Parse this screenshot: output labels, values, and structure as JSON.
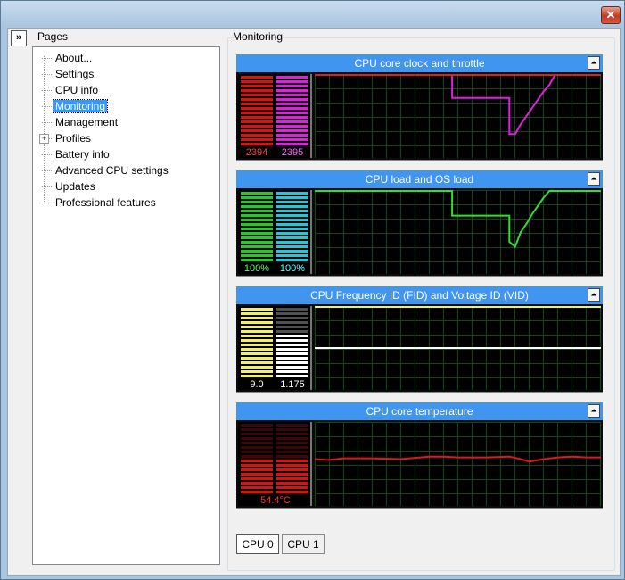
{
  "window": {
    "close_glyph": "✕",
    "close_icon": "close-icon"
  },
  "sidebar": {
    "expand_glyph": "»",
    "heading": "Pages",
    "items": [
      {
        "label": "About..."
      },
      {
        "label": "Settings"
      },
      {
        "label": "CPU info"
      },
      {
        "label": "Monitoring",
        "selected": true
      },
      {
        "label": "Management"
      },
      {
        "label": "Profiles",
        "expandable": true
      },
      {
        "label": "Battery info"
      },
      {
        "label": "Advanced CPU settings"
      },
      {
        "label": "Updates"
      },
      {
        "label": "Professional features"
      }
    ]
  },
  "main": {
    "heading": "Monitoring",
    "collapse_glyph": "⏶",
    "panels": [
      {
        "title": "CPU core clock and throttle",
        "meters": [
          {
            "value": "2394",
            "color": "#e01010",
            "text_color": "#ff4040",
            "fill": 1.0
          },
          {
            "value": "2395",
            "color": "#e020e0",
            "text_color": "#ff60ff",
            "fill": 1.0
          }
        ],
        "series": [
          {
            "color": "#e020e0",
            "points": [
              [
                0,
                100
              ],
              [
                48,
                100
              ],
              [
                48,
                72
              ],
              [
                68,
                72
              ],
              [
                68,
                28
              ],
              [
                70,
                28
              ],
              [
                72,
                40
              ],
              [
                74,
                50
              ],
              [
                76,
                60
              ],
              [
                78,
                70
              ],
              [
                80,
                80
              ],
              [
                82,
                88
              ],
              [
                84,
                100
              ],
              [
                100,
                100
              ]
            ]
          },
          {
            "color": "#e02020",
            "points": [
              [
                0,
                100
              ],
              [
                100,
                100
              ]
            ]
          }
        ]
      },
      {
        "title": "CPU load and OS load",
        "meters": [
          {
            "value": "100%",
            "color": "#22cc22",
            "text_color": "#60ff60",
            "fill": 1.0
          },
          {
            "value": "100%",
            "color": "#22c8d8",
            "text_color": "#60ffff",
            "fill": 1.0
          }
        ],
        "series": [
          {
            "color": "#30e030",
            "points": [
              [
                0,
                100
              ],
              [
                48,
                100
              ],
              [
                48,
                70
              ],
              [
                68,
                70
              ],
              [
                68,
                38
              ],
              [
                70,
                32
              ],
              [
                72,
                50
              ],
              [
                74,
                60
              ],
              [
                76,
                72
              ],
              [
                78,
                82
              ],
              [
                80,
                92
              ],
              [
                82,
                100
              ],
              [
                100,
                100
              ]
            ]
          }
        ]
      },
      {
        "title": "CPU Frequency ID (FID) and Voltage ID (VID)",
        "meters": [
          {
            "value": "9.0",
            "color": "#f0f060",
            "text_color": "#ffffff",
            "fill": 1.0
          },
          {
            "value": "1.175",
            "color": "#ffffff",
            "text_color": "#ffffff",
            "fill": 0.6,
            "dim": "#505050"
          }
        ],
        "series": [
          {
            "color": "#f0f060",
            "points": [
              [
                0,
                100
              ],
              [
                100,
                100
              ]
            ]
          },
          {
            "color": "#ffffff",
            "points": [
              [
                0,
                50
              ],
              [
                100,
                50
              ]
            ]
          }
        ]
      },
      {
        "title": "CPU core temperature",
        "meters": [
          {
            "value": "54.4°C",
            "color": "#e01010",
            "text_color": "#ff3030",
            "fill": 0.5,
            "dim": "#3a0808"
          },
          {
            "value": "",
            "color": "#e01010",
            "text_color": "#ff3030",
            "fill": 0.5,
            "dim": "#3a0808"
          }
        ],
        "series": [
          {
            "color": "#e01818",
            "points": [
              [
                0,
                56
              ],
              [
                5,
                55
              ],
              [
                10,
                57
              ],
              [
                20,
                57
              ],
              [
                30,
                56
              ],
              [
                40,
                59
              ],
              [
                45,
                59
              ],
              [
                50,
                58
              ],
              [
                60,
                58
              ],
              [
                68,
                59
              ],
              [
                72,
                56
              ],
              [
                75,
                53
              ],
              [
                80,
                56
              ],
              [
                85,
                58
              ],
              [
                90,
                59
              ],
              [
                95,
                58
              ],
              [
                100,
                58
              ]
            ]
          }
        ]
      }
    ],
    "tabs": [
      {
        "label": "CPU 0",
        "active": true
      },
      {
        "label": "CPU 1",
        "active": false
      }
    ]
  }
}
